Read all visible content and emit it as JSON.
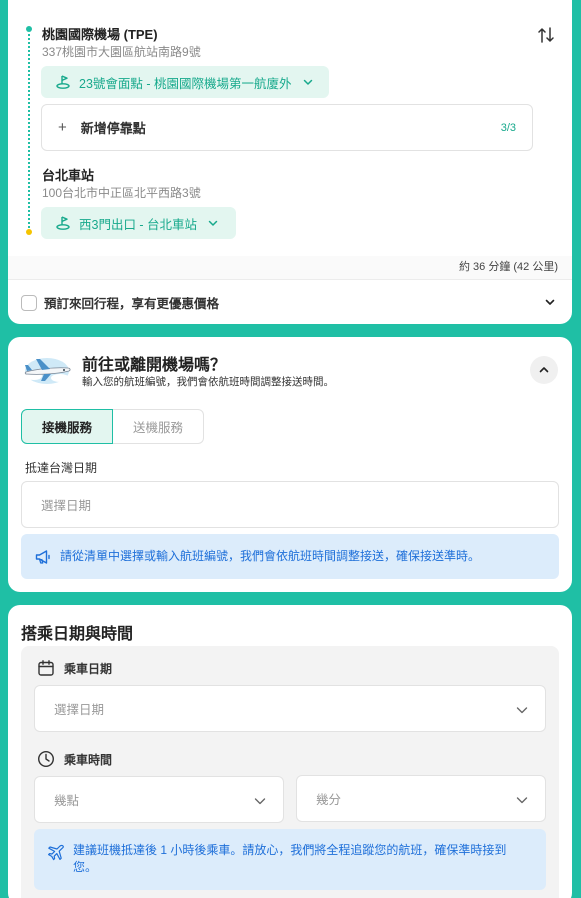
{
  "route": {
    "origin": {
      "name": "桃園國際機場 (TPE)",
      "address": "337桃園市大園區航站南路9號",
      "pickup_point": "23號會面點 - 桃園國際機場第一航廈外"
    },
    "add_stop": {
      "label": "新增停靠點",
      "count": "3/3"
    },
    "destination": {
      "name": "台北車站",
      "address": "100台北市中正區北平西路3號",
      "pickup_point": "西3門出口 - 台北車站"
    },
    "eta": "約 36 分鐘 (42 公里)",
    "round_trip_label": "預訂來回行程，享有更優惠價格",
    "colors": {
      "accent": "#1fbfa5",
      "origin_dot": "#1fbfa5",
      "destination_dot": "#f5c400"
    }
  },
  "flight": {
    "title": "前往或離開機場嗎？",
    "subtitle": "輸入您的航班編號，我們會依航班時間調整接送時間。",
    "tabs": [
      {
        "label": "接機服務",
        "active": true
      },
      {
        "label": "送機服務",
        "active": false
      }
    ],
    "date_label": "抵達台灣日期",
    "date_placeholder": "選擇日期",
    "info": "請從清單中選擇或輸入航班編號，我們會依航班時間調整接送，確保接送準時。"
  },
  "ride": {
    "title": "搭乘日期與時間",
    "date_label": "乘車日期",
    "date_placeholder": "選擇日期",
    "time_label": "乘車時間",
    "hour_placeholder": "幾點",
    "minute_placeholder": "幾分",
    "info": "建議班機抵達後 1 小時後乘車。請放心，我們將全程追蹤您的航班，確保準時接到您。"
  },
  "icons": {
    "swap": "swap-vertical-icon",
    "pickup": "pickup-point-icon",
    "chevron": "chevron-down-icon",
    "megaphone": "megaphone-icon",
    "calendar": "calendar-icon",
    "clock": "clock-icon",
    "plane": "airplane-icon"
  }
}
